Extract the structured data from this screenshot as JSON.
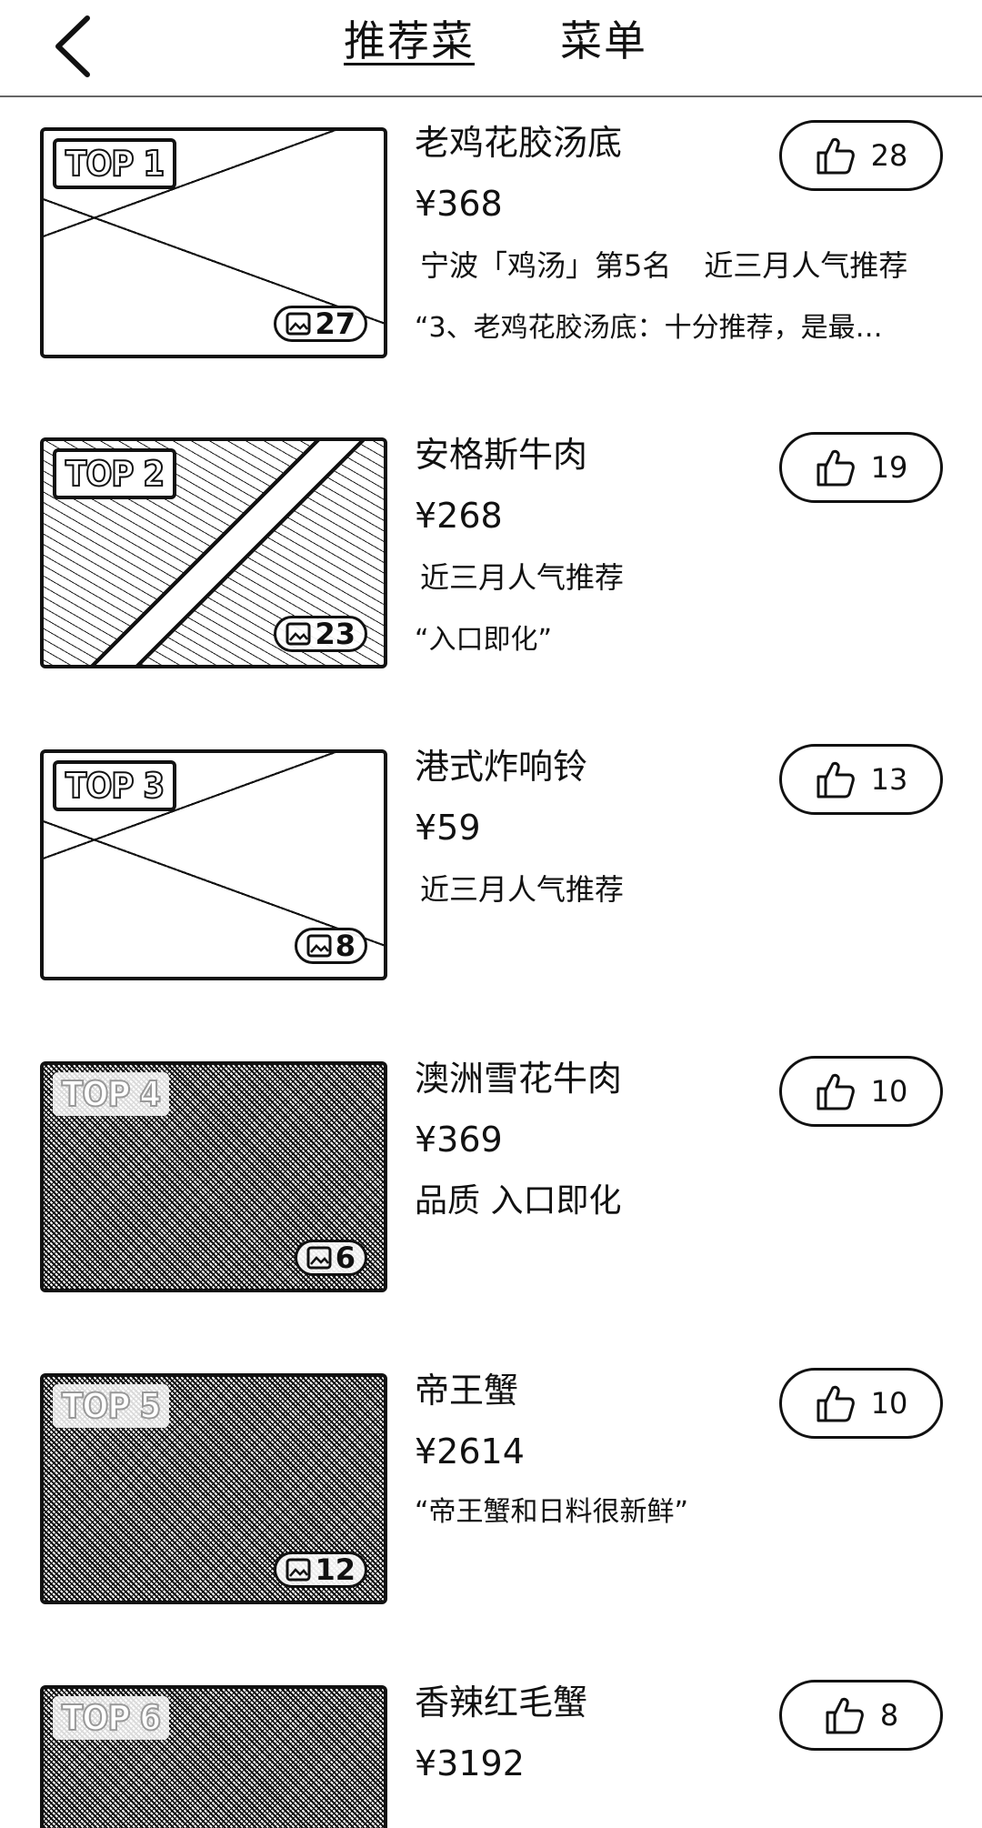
{
  "header": {
    "back_icon": "chevron-left-icon",
    "tabs": [
      {
        "label": "推荐菜",
        "active": true
      },
      {
        "label": "菜单",
        "active": false
      }
    ]
  },
  "dishes": [
    {
      "rank": "TOP 1",
      "photo_count": "27",
      "name": "老鸡花胶汤底",
      "price": "¥368",
      "tags": [
        "宁波「鸡汤」第5名",
        "近三月人气推荐"
      ],
      "quote": "“3、老鸡花胶汤底：十分推荐，是最…",
      "likes": "28"
    },
    {
      "rank": "TOP 2",
      "photo_count": "23",
      "name": "安格斯牛肉",
      "price": "¥268",
      "tags": [
        "近三月人气推荐"
      ],
      "quote": "“入口即化”",
      "likes": "19"
    },
    {
      "rank": "TOP 3",
      "photo_count": "8",
      "name": "港式炸响铃",
      "price": "¥59",
      "tags": [
        "近三月人气推荐"
      ],
      "quote": "",
      "likes": "13"
    },
    {
      "rank": "TOP 4",
      "photo_count": "6",
      "name": "澳洲雪花牛肉",
      "price": "¥369",
      "tags": [
        "品质 入口即化"
      ],
      "quote": "",
      "likes": "10"
    },
    {
      "rank": "TOP 5",
      "photo_count": "12",
      "name": "帝王蟹",
      "price": "¥2614",
      "tags": [],
      "quote": "“帝王蟹和日料很新鲜”",
      "likes": "10"
    },
    {
      "rank": "TOP 6",
      "photo_count": "",
      "name": "香辣红毛蟹",
      "price": "¥3192",
      "tags": [],
      "quote": "",
      "likes": "8"
    }
  ],
  "icons": {
    "like": "thumbs-up-icon",
    "photo": "image-icon"
  }
}
